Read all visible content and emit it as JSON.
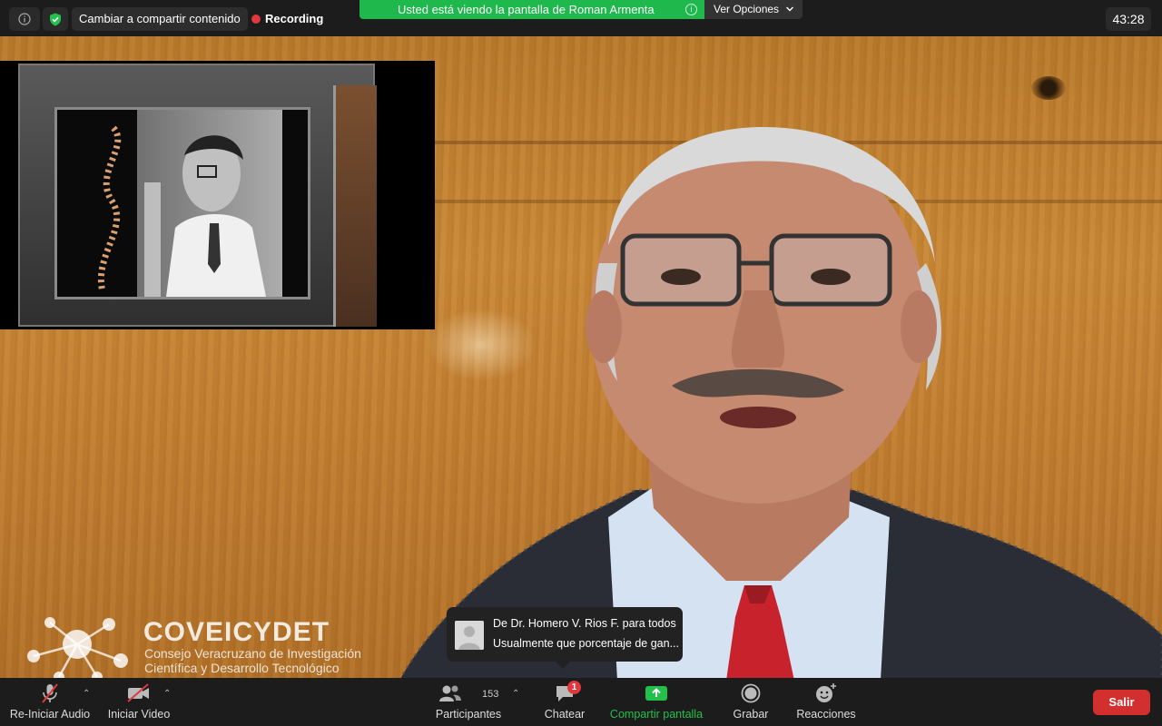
{
  "topbar": {
    "switch_label": "Cambiar a compartir contenido",
    "recording_label": "Recording",
    "banner_text": "Usted está viendo la pantalla de Roman Armenta",
    "options_label": "Ver Opciones",
    "timer": "43:28",
    "colors": {
      "banner": "#1fb84c",
      "recording_dot": "#e0383c"
    }
  },
  "logo": {
    "title": "COVEICYDET",
    "subtitle_line1": "Consejo Veracruzano de Investigación",
    "subtitle_line2": "Científica y Desarrollo Tecnológico"
  },
  "chat_toast": {
    "from": "De Dr. Homero V. Rios F. para todos",
    "message": "Usualmente que porcentaje de gan..."
  },
  "toolbar": {
    "audio_label": "Re-Iniciar Audio",
    "video_label": "Iniciar Video",
    "participants_label": "Participantes",
    "participants_count": "153",
    "chat_label": "Chatear",
    "chat_badge": "1",
    "share_label": "Compartir pantalla",
    "record_label": "Grabar",
    "reactions_label": "Reacciones",
    "exit_label": "Salir",
    "colors": {
      "share": "#23c14b",
      "exit": "#d32f2f"
    }
  }
}
